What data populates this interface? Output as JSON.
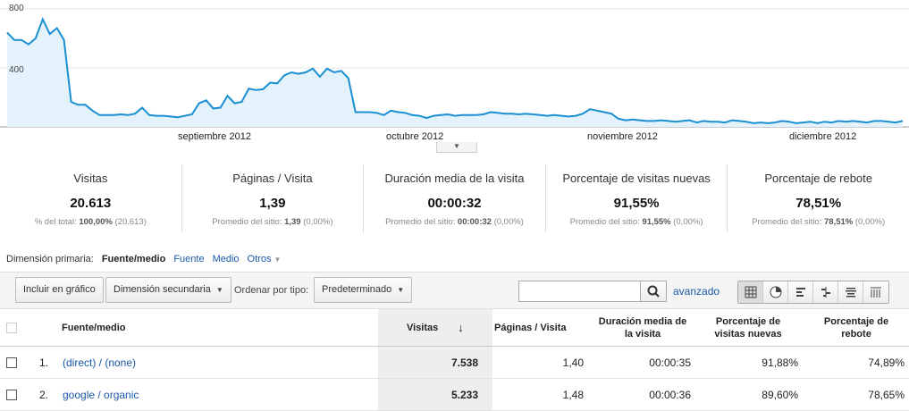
{
  "chart_data": {
    "type": "area",
    "series": [
      {
        "values": [
          640,
          590,
          590,
          560,
          600,
          730,
          630,
          670,
          590,
          170,
          150,
          150,
          110,
          80,
          80,
          80,
          85,
          80,
          90,
          130,
          80,
          75,
          75,
          70,
          65,
          75,
          85,
          160,
          180,
          125,
          130,
          210,
          160,
          170,
          260,
          250,
          255,
          300,
          295,
          350,
          370,
          360,
          370,
          395,
          340,
          395,
          370,
          380,
          330,
          100,
          100,
          100,
          95,
          80,
          110,
          100,
          95,
          80,
          75,
          60,
          75,
          80,
          85,
          75,
          80,
          80,
          80,
          85,
          100,
          95,
          90,
          90,
          85,
          90,
          85,
          80,
          75,
          80,
          75,
          70,
          75,
          90,
          120,
          110,
          100,
          90,
          55,
          45,
          50,
          45,
          40,
          40,
          45,
          40,
          35,
          40,
          45,
          30,
          40,
          35,
          35,
          30,
          45,
          40,
          35,
          25,
          30,
          25,
          30,
          40,
          35,
          25,
          30,
          35,
          25,
          35,
          30,
          40,
          35,
          40,
          35,
          30,
          40,
          40,
          35,
          30,
          40
        ]
      }
    ],
    "x_ticks": [
      "septiembre 2012",
      "octubre 2012",
      "noviembre 2012",
      "diciembre 2012"
    ],
    "y_ticks": [
      "800",
      "400"
    ],
    "ylim": [
      0,
      800
    ],
    "grid": true,
    "colors": {
      "line": "#1a8fd1",
      "fill": "#e4f2fb",
      "grid": "#e6e6e6"
    }
  },
  "metrics": [
    {
      "title": "Visitas",
      "value": "20.613",
      "sub_prefix": "% del total: ",
      "sub_bold": "100,00%",
      "sub_suffix": " (20.613)"
    },
    {
      "title": "Páginas / Visita",
      "value": "1,39",
      "sub_prefix": "Promedio del sitio: ",
      "sub_bold": "1,39",
      "sub_suffix": " (0,00%)"
    },
    {
      "title": "Duración media de la visita",
      "value": "00:00:32",
      "sub_prefix": "Promedio del sitio: ",
      "sub_bold": "00:00:32",
      "sub_suffix": " (0,00%)"
    },
    {
      "title": "Porcentaje de visitas nuevas",
      "value": "91,55%",
      "sub_prefix": "Promedio del sitio: ",
      "sub_bold": "91,55%",
      "sub_suffix": " (0,00%)"
    },
    {
      "title": "Porcentaje de rebote",
      "value": "78,51%",
      "sub_prefix": "Promedio del sitio: ",
      "sub_bold": "78,51%",
      "sub_suffix": " (0,00%)"
    }
  ],
  "dimension": {
    "label": "Dimensión primaria:",
    "active": "Fuente/medio",
    "link1": "Fuente",
    "link2": "Medio",
    "other": "Otros"
  },
  "toolbar": {
    "plot": "Incluir en gráfico",
    "secondary": "Dimensión secundaria",
    "sort_label": "Ordenar por tipo:",
    "sort_value": "Predeterminado",
    "search_value": "",
    "advanced": "avanzado"
  },
  "table": {
    "headers": {
      "source": "Fuente/medio",
      "visits": "Visitas",
      "pages": "Páginas / Visita",
      "duration": "Duración media de la visita",
      "new": "Porcentaje de visitas nuevas",
      "bounce": "Porcentaje de rebote"
    },
    "rows": [
      {
        "idx": "1.",
        "source": "(direct) / (none)",
        "visits": "7.538",
        "pages": "1,40",
        "duration": "00:00:35",
        "new": "91,88%",
        "bounce": "74,89%"
      },
      {
        "idx": "2.",
        "source": "google / organic",
        "visits": "5.233",
        "pages": "1,48",
        "duration": "00:00:36",
        "new": "89,60%",
        "bounce": "78,65%"
      }
    ]
  }
}
